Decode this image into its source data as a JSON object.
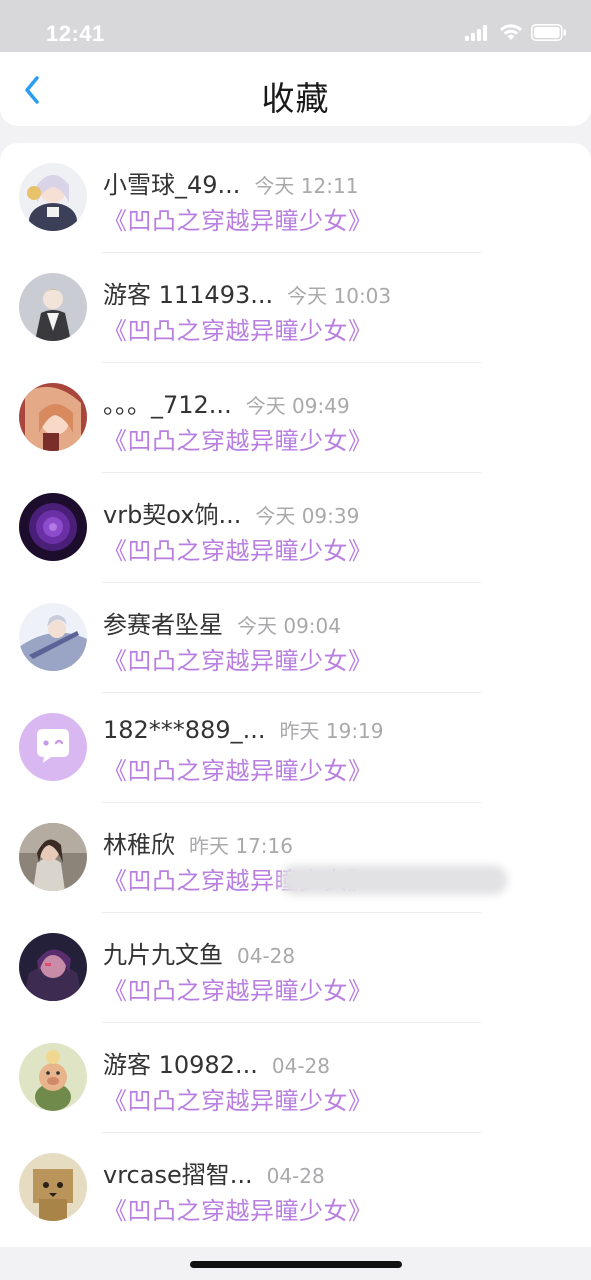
{
  "status_bar": {
    "time": "12:41"
  },
  "nav": {
    "title": "收藏"
  },
  "items": [
    {
      "name": "小雪球_49...",
      "time": "今天 12:11",
      "title": "《凹凸之穿越异瞳少女》",
      "avatar": "anime-girl-avatar"
    },
    {
      "name": "游客 111493...",
      "time": "今天 10:03",
      "title": "《凹凸之穿越异瞳少女》",
      "avatar": "anime-boy-avatar"
    },
    {
      "name": "。。。_712...",
      "time": "今天 09:49",
      "title": "《凹凸之穿越异瞳少女》",
      "avatar": "anime-girl-red-avatar"
    },
    {
      "name": "vrb契ox饷...",
      "time": "今天 09:39",
      "title": "《凹凸之穿越异瞳少女》",
      "avatar": "purple-rose-avatar"
    },
    {
      "name": "参赛者坠星",
      "time": "今天 09:04",
      "title": "《凹凸之穿越异瞳少女》",
      "avatar": "anime-warrior-avatar"
    },
    {
      "name": "182***889_...",
      "time": "昨天 19:19",
      "title": "《凹凸之穿越异瞳少女》",
      "avatar": "default-chat-avatar"
    },
    {
      "name": "林稚欣",
      "time": "昨天 17:16",
      "title": "《凹凸之穿越异瞳少女》",
      "avatar": "photo-girl-avatar"
    },
    {
      "name": "九片九文鱼",
      "time": "04-28",
      "title": "《凹凸之穿越异瞳少女》",
      "avatar": "dark-anime-avatar"
    },
    {
      "name": "游客 10982...",
      "time": "04-28",
      "title": "《凹凸之穿越异瞳少女》",
      "avatar": "cartoon-pig-avatar"
    },
    {
      "name": "vrcase摺智...",
      "time": "04-28",
      "title": "《凹凸之穿越异瞳少女》",
      "avatar": "danbo-box-avatar"
    }
  ],
  "colors": {
    "accent": "#2a9df4",
    "book_title": "#b87fe0",
    "time": "#a9a9ac",
    "name": "#333333"
  }
}
